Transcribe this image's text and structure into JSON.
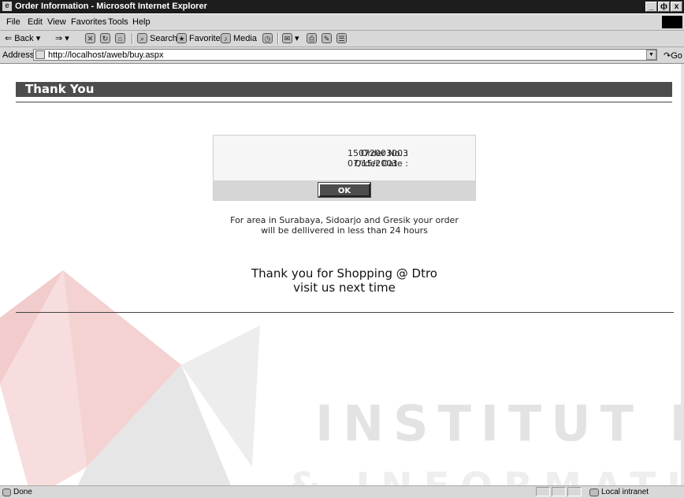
{
  "window": {
    "title": "Order Information - Microsoft Internet Explorer",
    "controls": [
      "_",
      "ф",
      "x"
    ]
  },
  "menu": [
    "File",
    "Edit",
    "View",
    "Favorites",
    "Tools",
    "Help"
  ],
  "toolbar": {
    "back_label": "Back",
    "search_label": "Search",
    "favorites_label": "Favorites",
    "media_label": "Media"
  },
  "address": {
    "label": "Address",
    "url": "http://localhost/aweb/buy.aspx",
    "go_label": "Go"
  },
  "page": {
    "header": "Thank You",
    "order_no_label": "Order No. :",
    "order_no": "15072003003",
    "order_date_label": "Order Date :",
    "order_date": "07/15/2003",
    "ok_label": "OK",
    "delivery_line1": "For area in Surabaya, Sidoarjo and Gresik your order",
    "delivery_line2": "will be dellivered in less than 24 hours",
    "thanks_line1": "Thank you for Shopping @ Dtro",
    "thanks_line2": "visit us next time"
  },
  "watermark": {
    "line1": "INSTITUT BISNIS",
    "line2": "& INFORMATIKA"
  },
  "status": {
    "text": "Done",
    "zone": "Local intranet"
  },
  "colors": {
    "header_bg": "#4d4d4d",
    "watermark_red": "#f0c9c9",
    "watermark_gray": "#d9d9d9"
  }
}
